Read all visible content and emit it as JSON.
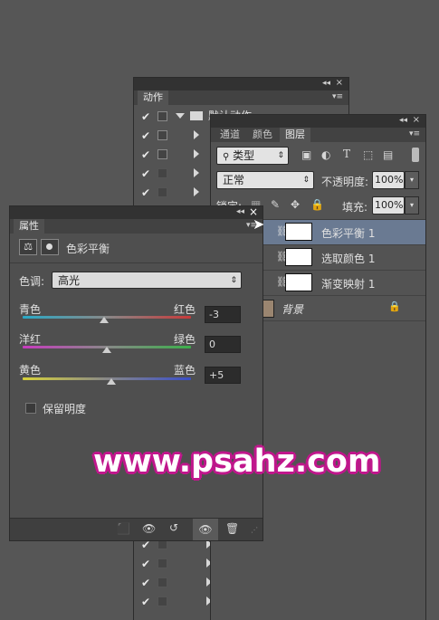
{
  "actions_panel": {
    "tab_label": "动作",
    "top_item_label": "默认动作"
  },
  "layers_panel": {
    "tabs": [
      "通道",
      "颜色",
      "图层"
    ],
    "filter_select": "类型",
    "blend_mode": "正常",
    "opacity_label": "不透明度:",
    "opacity_value": "100%",
    "lock_label": "锁定:",
    "fill_label": "填充:",
    "fill_value": "100%",
    "layers": [
      {
        "name": "色彩平衡 1"
      },
      {
        "name": "选取颜色 1"
      },
      {
        "name": "渐变映射 1"
      },
      {
        "name": "背景"
      }
    ]
  },
  "properties_panel": {
    "tab_label": "属性",
    "title": "色彩平衡",
    "tone_label": "色调:",
    "tone_value": "高光",
    "sliders": [
      {
        "left": "青色",
        "right": "红色",
        "value": "-3",
        "level": -3
      },
      {
        "left": "洋红",
        "right": "绿色",
        "value": "0",
        "level": 0
      },
      {
        "left": "黄色",
        "right": "蓝色",
        "value": "+5",
        "level": 5
      }
    ],
    "preserve_label": "保留明度"
  },
  "watermark": "www.psahz.com"
}
